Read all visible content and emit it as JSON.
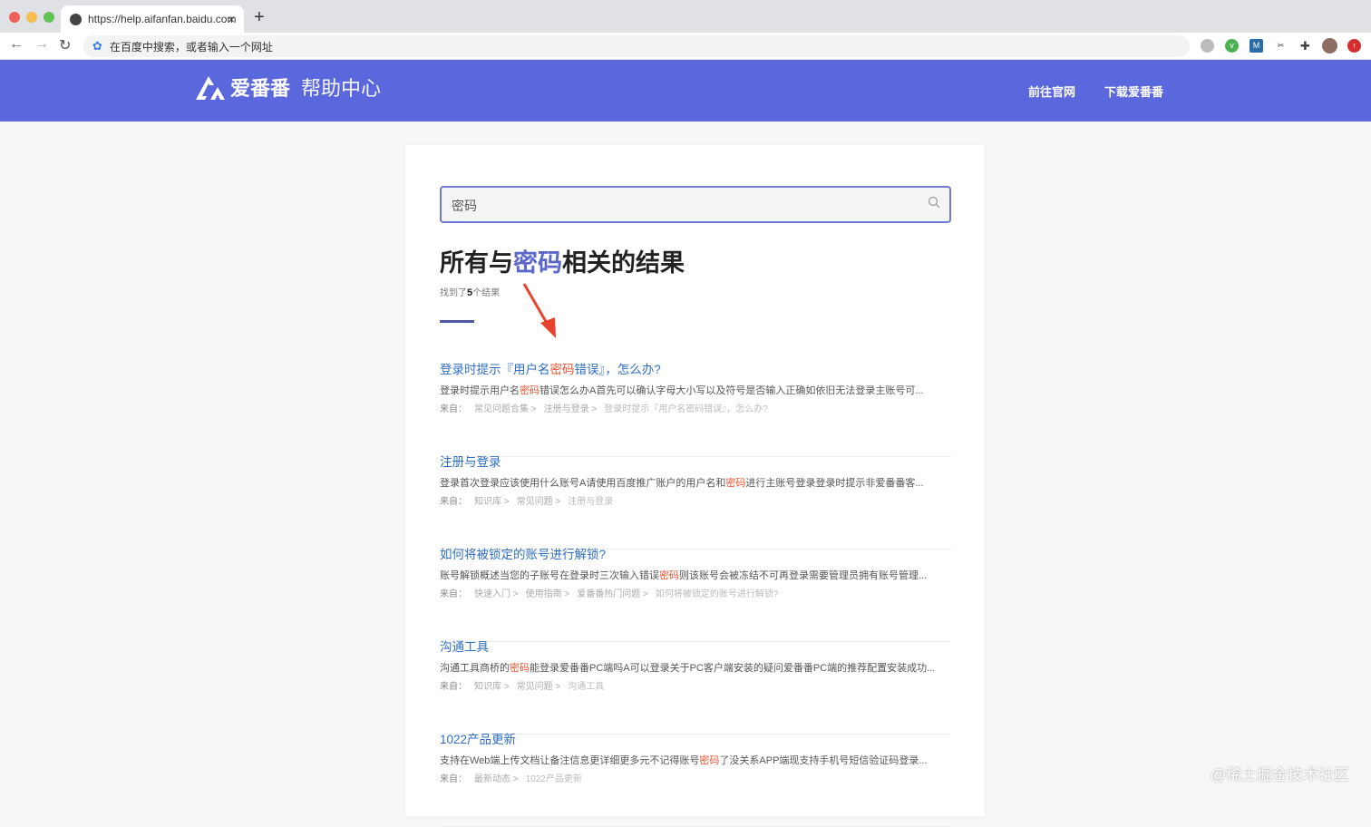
{
  "browser": {
    "tab_title": "https://help.aifanfan.baidu.com",
    "address_placeholder": "在百度中搜索，或者输入一个网址",
    "new_tab": "+",
    "close": "×"
  },
  "header": {
    "brand": "爱番番",
    "subtitle": "帮助中心",
    "links": [
      "前往官网",
      "下载爱番番"
    ],
    "bg_color": "#5b67dd"
  },
  "search": {
    "value": "密码"
  },
  "results_header": {
    "title_pre": "所有与",
    "title_keyword": "密码",
    "title_post": "相关的结果",
    "count_pre": "找到了",
    "count": "5",
    "count_post": "个结果"
  },
  "from_label": "来自：",
  "results": [
    {
      "title_pre": "登录时提示『用户名",
      "title_hl": "密码",
      "title_post": "错误』，怎么办?",
      "snip_pre": "登录时提示用户名",
      "snip_hl": "密码",
      "snip_post": "错误怎么办A首先可以确认字母大小写以及符号是否输入正确如依旧无法登录主账号可...",
      "crumbs": [
        "常见问题合集 >",
        "注册与登录 >",
        "登录时提示『用户名密码错误』，怎么办?"
      ]
    },
    {
      "title_pre": "注册与登录",
      "title_hl": "",
      "title_post": "",
      "snip_pre": "登录首次登录应该使用什么账号A请使用百度推广账户的用户名和",
      "snip_hl": "密码",
      "snip_post": "进行主账号登录登录时提示非爱番番客...",
      "crumbs": [
        "知识库 >",
        "常见问题 >",
        "注册与登录"
      ]
    },
    {
      "title_pre": "如何将被锁定的账号进行解锁?",
      "title_hl": "",
      "title_post": "",
      "snip_pre": "账号解锁概述当您的子账号在登录时三次输入错误",
      "snip_hl": "密码",
      "snip_post": "则该账号会被冻结不可再登录需要管理员拥有账号管理...",
      "crumbs": [
        "快速入门 >",
        "使用指南 >",
        "爱番番热门问题 >",
        "如何将被锁定的账号进行解锁?"
      ]
    },
    {
      "title_pre": "沟通工具",
      "title_hl": "",
      "title_post": "",
      "snip_pre": "沟通工具商桥的",
      "snip_hl": "密码",
      "snip_post": "能登录爱番番PC端吗A可以登录关于PC客户端安装的疑问爱番番PC端的推荐配置安装成功...",
      "crumbs": [
        "知识库 >",
        "常见问题 >",
        "沟通工具"
      ]
    },
    {
      "title_pre": "1022产品更新",
      "title_hl": "",
      "title_post": "",
      "snip_pre": "支持在Web端上传文档让备注信息更详细更多元不记得账号",
      "snip_hl": "密码",
      "snip_post": "了没关系APP端现支持手机号短信验证码登录...",
      "crumbs": [
        "最新动态 >",
        "1022产品更新"
      ]
    }
  ],
  "watermark": "@稀土掘金技术社区"
}
